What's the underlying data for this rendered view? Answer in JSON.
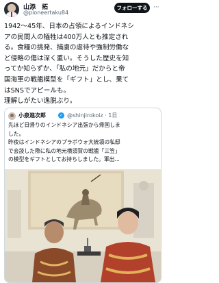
{
  "author": {
    "name": "山添　拓",
    "handle": "@pioneertaku84",
    "follow_label": "フォローする",
    "more_label": "···"
  },
  "tweet": {
    "lines": [
      "1942〜45年、日本の占領によるインドネシ",
      "アの民間人の犠牲は400万人とも推定され",
      "る。食糧の挑発、捕虜の虐待や強制労働な",
      "ど侵略の傷は深く重い。そうした歴史を知",
      "ってか知らずか、「私の地元」だからと帝",
      "国海軍の戦艦模型を「ギフト」とし、果て",
      "はSNSでアピールも。",
      "理解しがたい逸脱ぶり。"
    ]
  },
  "quote": {
    "name": "小泉進次郎",
    "handle_time": "@shinjirokoiz · 1日",
    "verified_mark": "✓",
    "lines": [
      "先ほど日帰りのインドネシア出張から帰国しま",
      "した。",
      "昨夜はインドネシアのプラボウォ大統領の私邸",
      "で会談した際に私の地元横須賀の戦艦「三笠」",
      "の模型をギフトとしてお持ちしました。軍出..."
    ]
  },
  "colors": {
    "accent": "#1d9bf0",
    "text": "#0f1419",
    "muted": "#536471",
    "border": "#cfd9de"
  },
  "icons": [
    "verified-badge-icon",
    "more-options-icon"
  ]
}
